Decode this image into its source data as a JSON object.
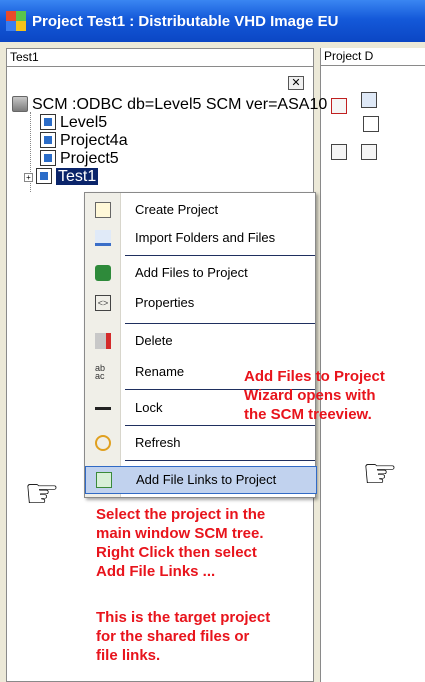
{
  "window": {
    "title": "Project  Test1 : Distributable VHD Image EU"
  },
  "left_pane": {
    "header": "Test1",
    "close_glyph": "✕"
  },
  "right_pane": {
    "header": "Project D"
  },
  "tree": {
    "root": "SCM :ODBC db=Level5 SCM ver=ASA10",
    "items": [
      "Level5",
      "Project4a",
      "Project5",
      "Test1"
    ],
    "expand_glyph": "+"
  },
  "context_menu": {
    "items": [
      {
        "label": "Create Project",
        "icon": "create-project-icon"
      },
      {
        "label": "Import Folders and Files",
        "icon": "import-icon"
      },
      {
        "label": "Add Files to Project",
        "icon": "add-files-icon"
      },
      {
        "label": "Properties",
        "icon": "properties-icon"
      },
      {
        "label": "Delete",
        "icon": "delete-icon"
      },
      {
        "label": "Rename",
        "icon": "rename-icon"
      },
      {
        "label": "Lock",
        "icon": "lock-icon"
      },
      {
        "label": "Refresh",
        "icon": "refresh-icon"
      },
      {
        "label": "Add File Links to Project",
        "icon": "add-file-links-icon"
      }
    ],
    "highlighted": "Add File Links to Project"
  },
  "annotations": {
    "wizard_note": [
      "Add Files to Project",
      "Wizard opens with",
      "the SCM treeview."
    ],
    "select_note": [
      "Select the project in the",
      "main window SCM tree.",
      "Right Click then select",
      "Add File Links ..."
    ],
    "target_note": [
      "This is the target project",
      "for the shared files or",
      "file links."
    ]
  },
  "colors": {
    "titlebar": "#0b46c4",
    "annotation": "#e8141c",
    "menu_highlight": "#c1d2ee"
  }
}
